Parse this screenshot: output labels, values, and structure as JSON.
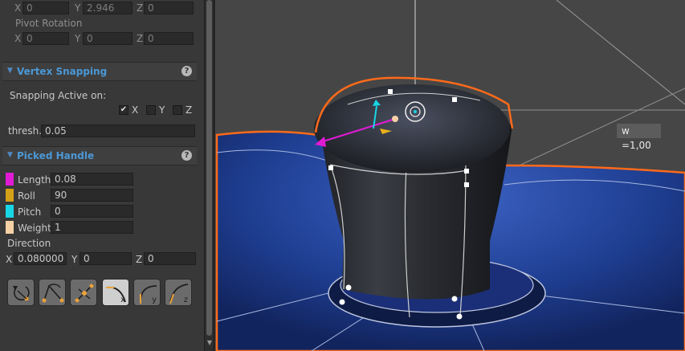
{
  "pivot_position": {
    "x_label": "X",
    "x_value": "0",
    "y_label": "Y",
    "y_value": "2.946",
    "z_label": "Z",
    "z_value": "0"
  },
  "pivot_rotation": {
    "title": "Pivot Rotation",
    "x_label": "X",
    "x_value": "0",
    "y_label": "Y",
    "y_value": "0",
    "z_label": "Z",
    "z_value": "0"
  },
  "vertex_snapping": {
    "title": "Vertex Snapping",
    "help": "?",
    "active_label": "Snapping Active on:",
    "x": {
      "label": "X",
      "checked": "✔"
    },
    "y": {
      "label": "Y"
    },
    "z": {
      "label": "Z"
    },
    "thresh_label": "thresh.",
    "thresh_value": "0.05"
  },
  "picked_handle": {
    "title": "Picked Handle",
    "help": "?",
    "rows": [
      {
        "label": "Length",
        "value": "0.08",
        "color": "#e01bd4"
      },
      {
        "label": "Roll",
        "value": "90",
        "color": "#d4a017"
      },
      {
        "label": "Pitch",
        "value": "0",
        "color": "#17d6e6"
      },
      {
        "label": "Weight",
        "value": "1",
        "color": "#f5d2a6"
      }
    ],
    "direction_label": "Direction",
    "dir_x_label": "X",
    "dir_x_value": "0.080000",
    "dir_y_label": "Y",
    "dir_y_value": "0",
    "dir_z_label": "Z",
    "dir_z_value": "0"
  },
  "tools": [
    {
      "icon": "rotate-handle-icon",
      "axis": ""
    },
    {
      "icon": "mirror-handle-icon",
      "axis": ""
    },
    {
      "icon": "split-handle-icon",
      "axis": ""
    },
    {
      "icon": "curve-x-icon",
      "axis": "x"
    },
    {
      "icon": "curve-y-icon",
      "axis": "y"
    },
    {
      "icon": "curve-z-icon",
      "axis": "z"
    }
  ],
  "viewport": {
    "weight_label": "w =1,00",
    "accent": "#ff6a1a"
  }
}
